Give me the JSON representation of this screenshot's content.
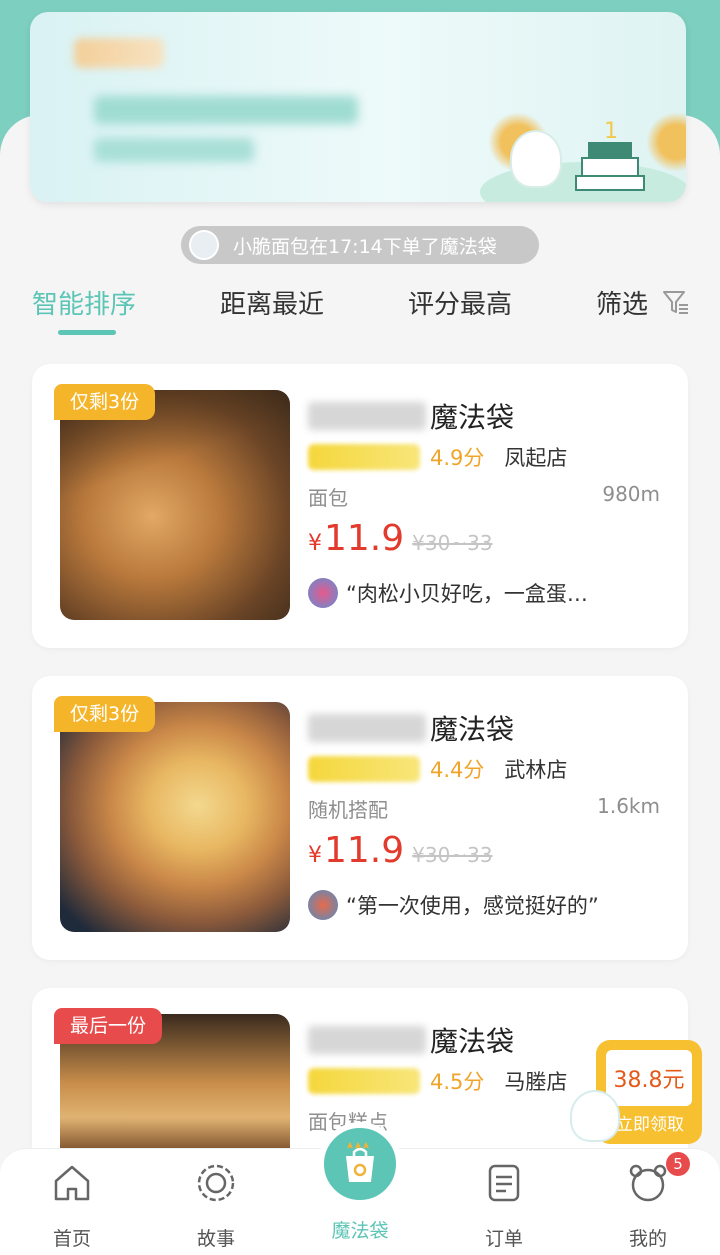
{
  "notice": {
    "text": "小脆面包在17:14下单了魔法袋"
  },
  "sort_tabs": [
    {
      "label": "智能排序",
      "active": true
    },
    {
      "label": "距离最近",
      "active": false
    },
    {
      "label": "评分最高",
      "active": false
    },
    {
      "label": "筛选",
      "active": false
    }
  ],
  "cards": [
    {
      "tag": "仅剩3份",
      "tag_color": "#f5b52a",
      "name_suffix": "魔法袋",
      "score": "4.9分",
      "branch": "凤起店",
      "category": "面包",
      "distance": "980m",
      "currency": "¥",
      "price": "11.9",
      "original_price": "¥30~33",
      "review": "“肉松小贝好吃，一盒蛋…"
    },
    {
      "tag": "仅剩3份",
      "tag_color": "#f5b52a",
      "name_suffix": "魔法袋",
      "score": "4.4分",
      "branch": "武林店",
      "category": "随机搭配",
      "distance": "1.6km",
      "currency": "¥",
      "price": "11.9",
      "original_price": "¥30~33",
      "review": "“第一次使用，感觉挺好的”"
    },
    {
      "tag": "最后一份",
      "tag_color": "#e84b4b",
      "name_suffix": "魔法袋",
      "score": "4.5分",
      "branch": "马塍店",
      "category": "面包糕点"
    }
  ],
  "coupon": {
    "amount": "38.8元",
    "label": "立即领取"
  },
  "bottom_nav": {
    "home": "首页",
    "story": "故事",
    "magic_bag": "魔法袋",
    "orders": "订单",
    "mine": "我的",
    "mine_badge": "5"
  },
  "colors": {
    "accent": "#5cc5b6",
    "price_red": "#e33a2e",
    "score_orange": "#f0a52a"
  }
}
